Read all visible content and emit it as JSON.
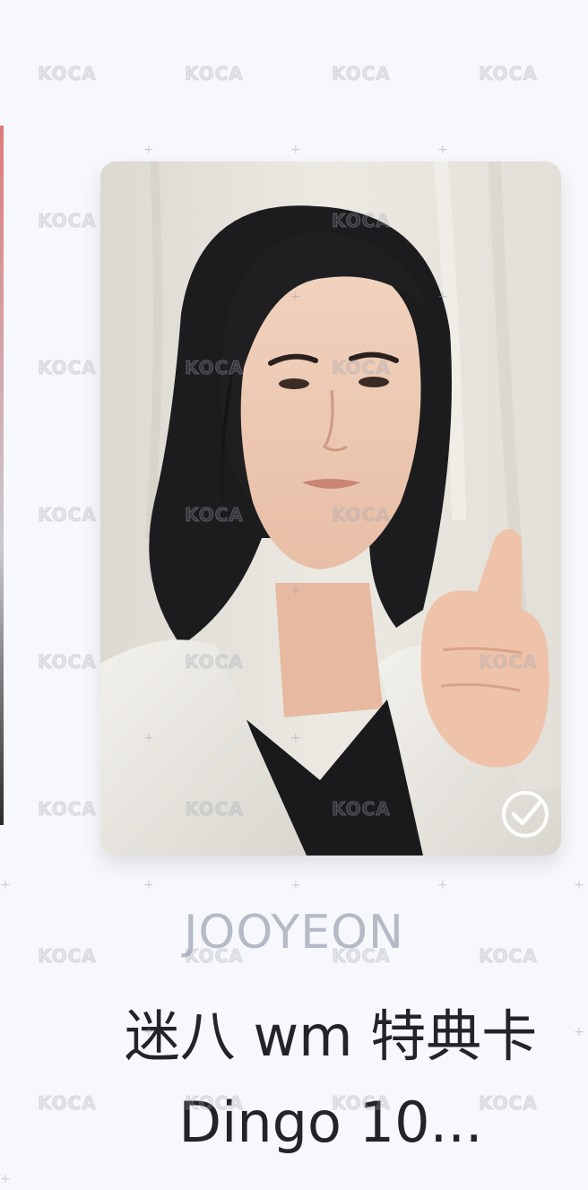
{
  "card": {
    "member_name": "JOOYEON",
    "title": "迷八 wm 特典卡 Dingo 10...",
    "photo_alt": "photocard-image",
    "selected": true
  },
  "watermark": {
    "text": "KOCA"
  },
  "icons": {
    "selected_check": "check-circle-icon"
  },
  "colors": {
    "background": "#f7f8fb",
    "name_color": "#b4bac6",
    "title_color": "#232427"
  }
}
